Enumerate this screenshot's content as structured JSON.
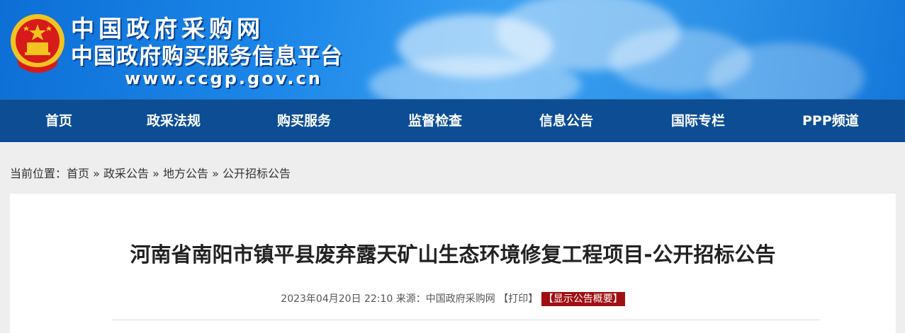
{
  "header": {
    "site_name": "中国政府采购网",
    "subtitle": "中国政府购买服务信息平台",
    "url": "www.ccgp.gov.cn",
    "emblem_icon": "national-emblem-icon",
    "colors": {
      "banner": "#1b86e8",
      "nav": "#0c4d94",
      "accent_red": "#a00f12"
    }
  },
  "nav": {
    "items": [
      {
        "label": "首页"
      },
      {
        "label": "政采法规"
      },
      {
        "label": "购买服务"
      },
      {
        "label": "监督检查"
      },
      {
        "label": "信息公告"
      },
      {
        "label": "国际专栏"
      },
      {
        "label": "PPP频道"
      }
    ]
  },
  "breadcrumb": {
    "prefix": "当前位置：",
    "items": [
      "首页",
      "政采公告",
      "地方公告",
      "公开招标公告"
    ],
    "separator": "»"
  },
  "article": {
    "title": "河南省南阳市镇平县废弃露天矿山生态环境修复工程项目-公开招标公告",
    "datetime": "2023年04月20日 22:10",
    "source_label": "来源：",
    "source": "中国政府采购网",
    "print_label": "【打印】",
    "summary_label": "【显示公告概要】"
  }
}
